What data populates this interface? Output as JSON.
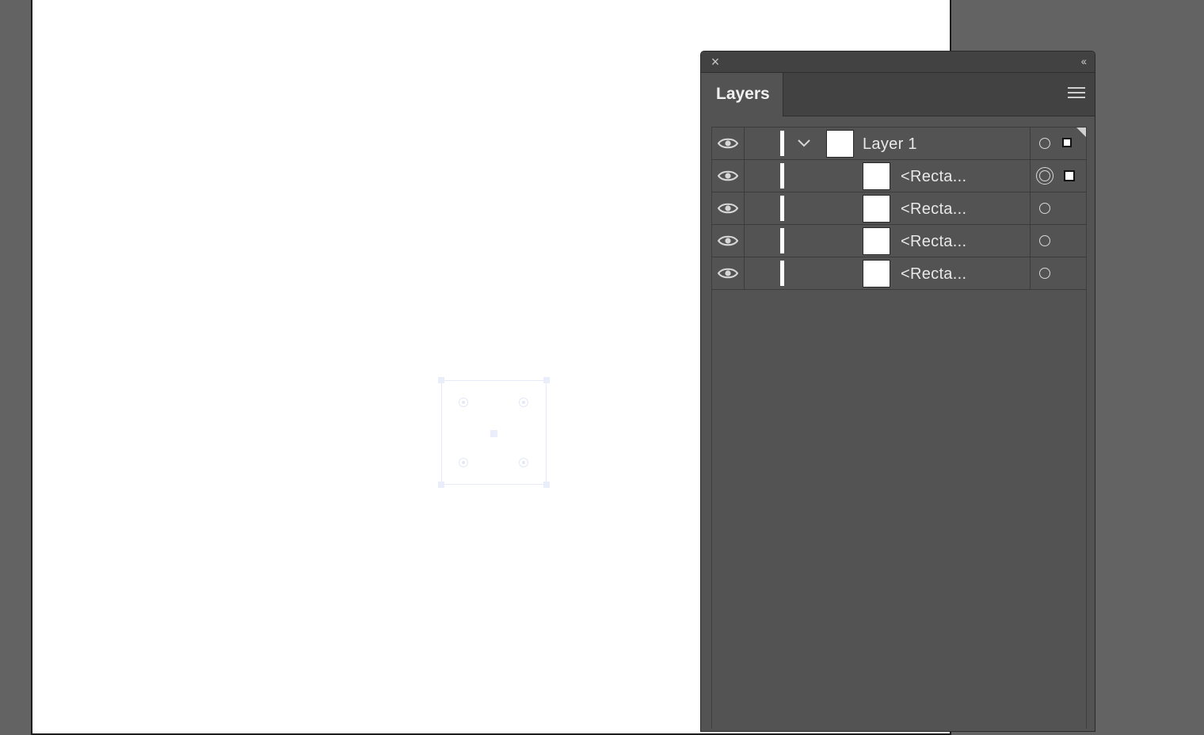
{
  "panel": {
    "close_icon": "close-icon",
    "collapse_glyph": "‹‹",
    "tab_label": "Layers",
    "menu_icon": "hamburger-menu-icon"
  },
  "layers": [
    {
      "name": "Layer 1",
      "type": "layer",
      "expanded": true,
      "visible": true,
      "targeted": false,
      "selected": true
    },
    {
      "name": "<Recta...",
      "type": "object",
      "visible": true,
      "targeted": true,
      "selected": true
    },
    {
      "name": "<Recta...",
      "type": "object",
      "visible": true,
      "targeted": false,
      "selected": false
    },
    {
      "name": "<Recta...",
      "type": "object",
      "visible": true,
      "targeted": false,
      "selected": false
    },
    {
      "name": "<Recta...",
      "type": "object",
      "visible": true,
      "targeted": false,
      "selected": false
    }
  ],
  "colors": {
    "layer_color": "#ffffff",
    "panel_bg": "#535353",
    "canvas_bg": "#636363"
  }
}
